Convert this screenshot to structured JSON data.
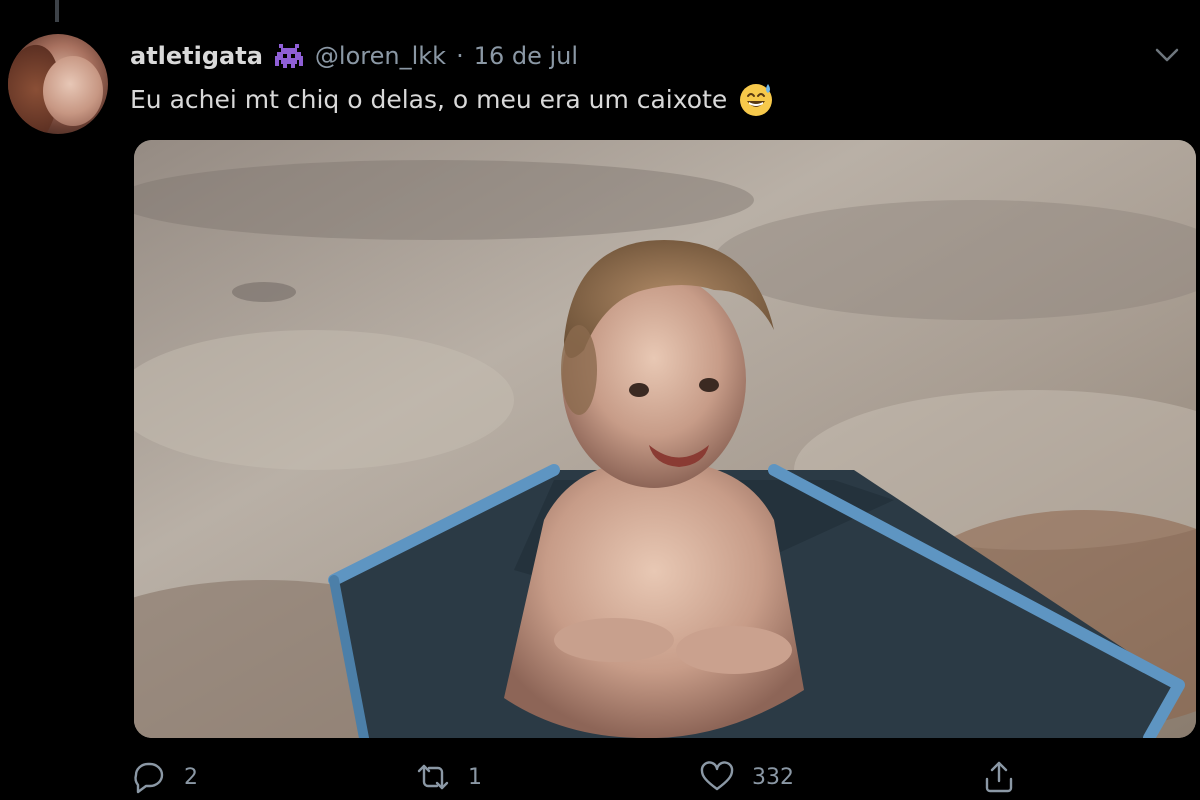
{
  "tweet": {
    "display_name": "atletigata",
    "badge_icon": "purple-space-invader-icon",
    "handle": "@loren_lkk",
    "separator": "·",
    "date": "16 de jul",
    "text": "Eu achei mt chiq o delas, o meu era um caixote",
    "emoji": "grinning-face-with-sweat-emoji"
  },
  "actions": {
    "reply_count": "2",
    "retweet_count": "1",
    "like_count": "332"
  },
  "colors": {
    "background": "#000000",
    "primary_text": "#d9d9d9",
    "secondary_text": "#8b98a5",
    "badge": "#8f5fd6"
  }
}
